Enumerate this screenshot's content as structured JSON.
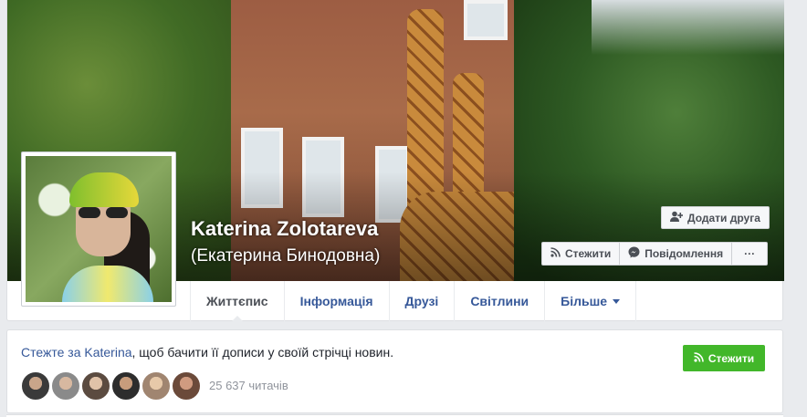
{
  "profile": {
    "name": "Katerina Zolotareva",
    "alternate_name": "(Екатерина Бинодовна)"
  },
  "actions": {
    "add_friend": "Додати друга",
    "follow": "Стежити",
    "message": "Повідомлення",
    "more": "···"
  },
  "nav": {
    "tabs": [
      {
        "label": "Життєпис",
        "active": true
      },
      {
        "label": "Інформація",
        "active": false
      },
      {
        "label": "Друзі",
        "active": false
      },
      {
        "label": "Світлини",
        "active": false
      },
      {
        "label": "Більше",
        "active": false
      }
    ]
  },
  "follow_card": {
    "link_text": "Стежте за Katerina",
    "rest_text": ", щоб бачити її дописи у своїй стрічці новин.",
    "button_label": "Стежити",
    "reader_count": "25 637 читачів"
  },
  "colors": {
    "link": "#365899",
    "follow_green": "#42b72a",
    "page_bg": "#e9ebee"
  },
  "icons": {
    "add_friend": "add-friend-icon",
    "follow": "rss-icon",
    "message": "messenger-icon",
    "more_caret": "chevron-down-icon"
  }
}
